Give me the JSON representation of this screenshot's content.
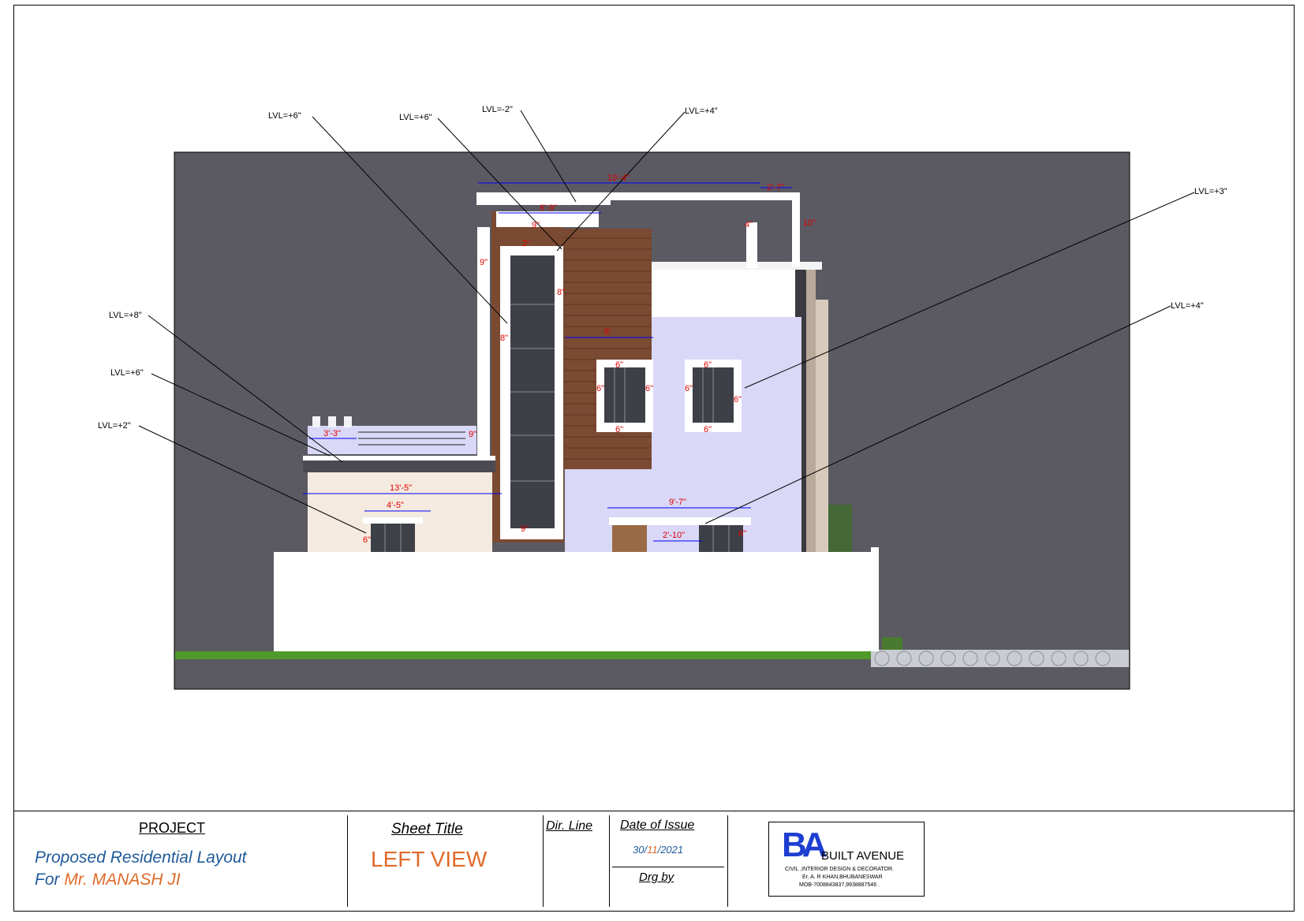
{
  "elevation": {
    "level_callouts": [
      "LVL=+6\"",
      "LVL=+6\"",
      "LVL=-2\"",
      "LVL=+4\"",
      "LVL=+3\"",
      "LVL=+8\"",
      "LVL=+6\"",
      "LVL=+2\"",
      "LVL=+4\""
    ],
    "dimensions": [
      "19'-4\"",
      "2'-7\"",
      "6'-9\"",
      "9\"",
      "2'",
      "9\"",
      "8\"",
      "8\"",
      "6'",
      "6\"",
      "6\"",
      "6\"",
      "6\"",
      "6\"",
      "6\"",
      "6\"",
      "6\"",
      "10\"",
      "4\"",
      "3'-3\"",
      "9\"",
      "13'-5\"",
      "4'-5\"",
      "9'-7\"",
      "2'-10\"",
      "6\"",
      "6\"",
      "9\""
    ],
    "colors": {
      "background": "#5b5a62",
      "wall": "#ffffff",
      "lavender": "#d9d8f7",
      "wood": "#7a4a32",
      "window": "#3e4048",
      "grass": "#4f9a2b",
      "dimension": "#e00000",
      "dim_line": "#0000ff"
    }
  },
  "title_block": {
    "project_heading": "PROJECT",
    "project_line1": "Proposed Residential Layout",
    "project_line2_prefix": "For",
    "project_line2_name": "Mr. MANASH  JI",
    "sheet_title_heading": "Sheet Title",
    "sheet_title": "LEFT VIEW",
    "dir_line": "Dir. Line",
    "date_heading": "Date of Issue",
    "date_day": "30/",
    "date_month": "11",
    "date_year": "/2021",
    "drg_by": "Drg by",
    "logo_initials": "BA",
    "company_name": "BUILT AVENUE",
    "company_tagline": "CIVIL ,INTERIOR DESIGN & DECORATOR.",
    "company_person": "Er. A. R KHAN,BHUBANESWAR",
    "company_mobile": "MOB-7008843837,9938887546 ."
  }
}
